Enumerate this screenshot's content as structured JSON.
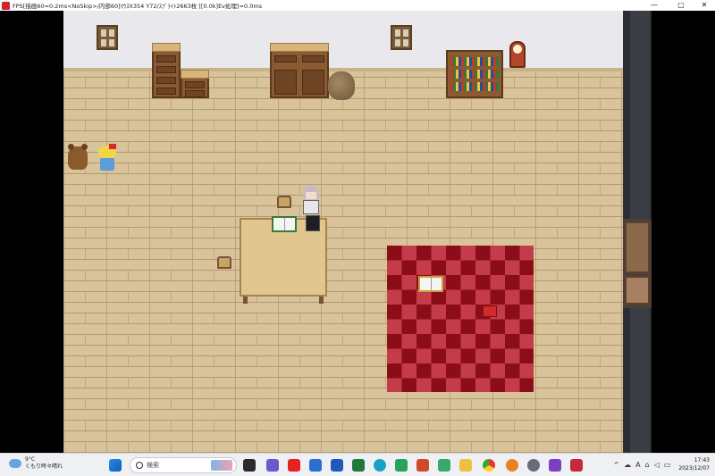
{
  "window": {
    "title": "FPS[描画60=0.2ms<NoSkip>/内部60]ﾏｳｽX354 Y72/ｽﾌﾟﾗｲﾄ2663枚 [[0.0k]Ev処理]=0.0ms",
    "minimize_glyph": "—",
    "maximize_glyph": "▢",
    "close_glyph": "✕"
  },
  "taskbar": {
    "weather": {
      "temp": "9°C",
      "desc": "くもり時々晴れ"
    },
    "search": {
      "label": "検索"
    },
    "tray_chevron": "^",
    "tray_ime": "A",
    "clock": {
      "time": "17:43",
      "date": "2023/12/07"
    },
    "pinned_apps": [
      "start-icon",
      "search-icon",
      "task-view-icon",
      "chat-icon",
      "youtube-icon",
      "store-icon",
      "word-icon",
      "excel-icon",
      "edge-icon",
      "teams-icon",
      "powerpoint-icon",
      "explorer-icon",
      "chrome-icon",
      "blender-icon",
      "settings-icon",
      "rpgmaker-icon",
      "game-icon"
    ]
  },
  "colors": {
    "floor": "#d8c39a",
    "carpet_dark": "#8b0d18",
    "carpet_light": "#c43c4a",
    "wall": "#e9e8ec",
    "taskbar": "#eef0f4"
  }
}
